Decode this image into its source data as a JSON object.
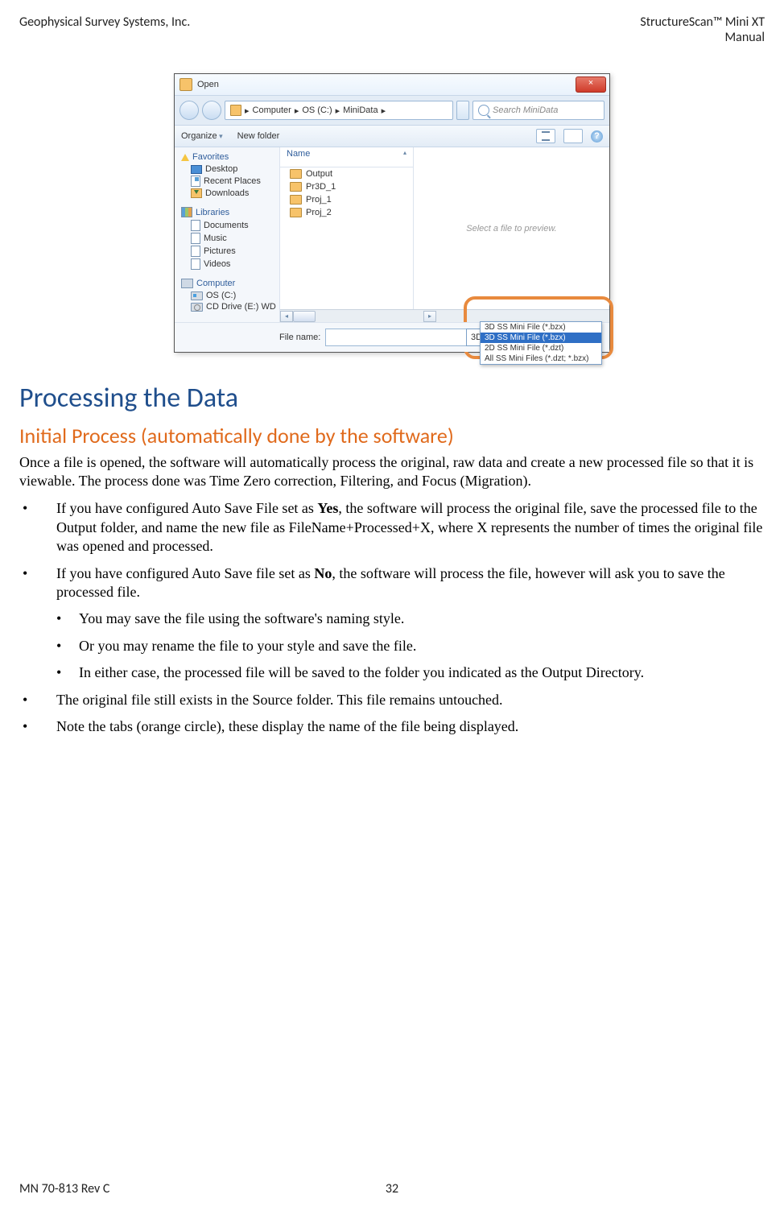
{
  "header": {
    "left": "Geophysical Survey Systems, Inc.",
    "right_line1": "StructureScan™ Mini XT",
    "right_line2": "Manual"
  },
  "footer": {
    "left": "MN 70-813 Rev C",
    "page": "32"
  },
  "screenshot": {
    "title": "Open",
    "close": "×",
    "breadcrumb": [
      "Computer",
      "OS (C:)",
      "MiniData"
    ],
    "breadcrumb_sep": "▸",
    "search_placeholder": "Search MiniData",
    "toolbar": {
      "organize": "Organize",
      "newfolder": "New folder",
      "help": "?"
    },
    "sidebar": {
      "favorites": "Favorites",
      "fav_items": [
        "Desktop",
        "Recent Places",
        "Downloads"
      ],
      "libraries": "Libraries",
      "lib_items": [
        "Documents",
        "Music",
        "Pictures",
        "Videos"
      ],
      "computer": "Computer",
      "comp_items": [
        "OS (C:)",
        "CD Drive (E:) WD"
      ]
    },
    "list": {
      "header": "Name",
      "items": [
        "Output",
        "Pr3D_1",
        "Proj_1",
        "Proj_2"
      ]
    },
    "preview": "Select a file to preview.",
    "filename_label": "File name:",
    "filetype_selected": "3D SS Mini File (*.bzx)",
    "filetype_options": [
      "3D SS Mini File (*.bzx)",
      "3D SS Mini File (*.bzx)",
      "2D SS Mini File (*.dzt)",
      "All SS Mini Files (*.dzt; *.bzx)"
    ]
  },
  "doc": {
    "h1": "Processing the Data",
    "h2": "Initial Process (automatically done by the software)",
    "p1": "Once a file is opened, the software will automatically process the original, raw data and create a new processed file so that it is viewable. The process done was Time Zero correction, Filtering, and Focus (Migration).",
    "b1a": "If you have configured Auto Save File set as ",
    "b1_bold": "Yes",
    "b1b": ", the software will process the original file, save the processed file to the Output folder, and name the new file as FileName+Processed+X, where X represents the number of times the original file was opened and processed.",
    "b2a": "If you have configured Auto Save file set as ",
    "b2_bold": "No",
    "b2b": ", the software will process the file, however will ask you to save the processed file.",
    "b2_sub1": "You may save the file using the software's naming style.",
    "b2_sub2": "Or you may rename the file to your style and save the file.",
    "b2_sub3": "In either case, the processed file will be saved to the folder you indicated as the Output Directory.",
    "b3": "The original file still exists in the Source folder. This file remains untouched.",
    "b4": "Note the tabs (orange circle), these display the name of the file being displayed."
  }
}
